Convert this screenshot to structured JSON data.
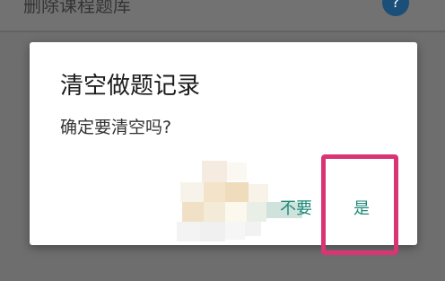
{
  "background": {
    "header_text": "删除课程题库",
    "badge_text": "?"
  },
  "dialog": {
    "title": "清空做题记录",
    "message": "确定要清空吗?",
    "buttons": {
      "negative_label": "不要",
      "positive_label": "是"
    }
  },
  "colors": {
    "accent": "#1f8a7a",
    "highlight": "#d93474",
    "overlay": "#6e6e6e",
    "dialog_bg": "#ffffff"
  }
}
